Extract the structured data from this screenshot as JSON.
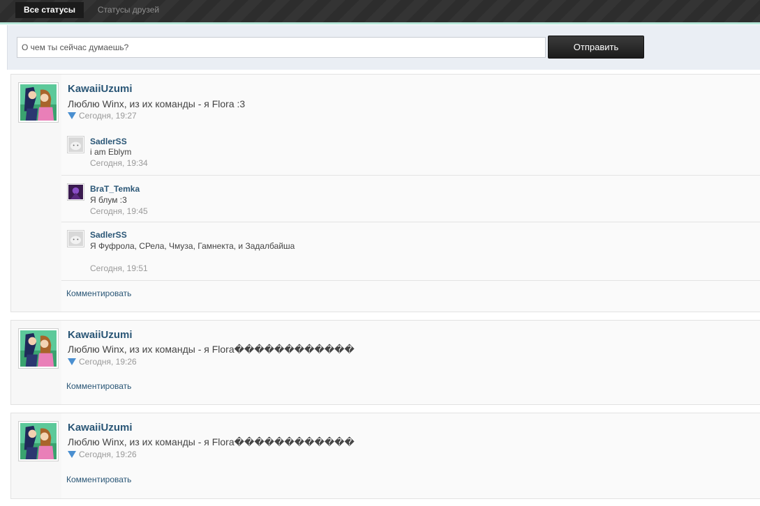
{
  "tabs": {
    "all": "Все статусы",
    "friends": "Статусы друзей"
  },
  "composer": {
    "placeholder": "О чем ты сейчас думаешь?",
    "send_label": "Отправить"
  },
  "posts": [
    {
      "author": "KawaiiUzumi",
      "text": "Люблю Winx, из их команды - я Flora :3",
      "time": "Сегодня, 19:27",
      "comments": [
        {
          "author": "SadlerSS",
          "text": "i am Eblym",
          "time": "Сегодня, 19:34"
        },
        {
          "author": "BraT_Temka",
          "text": "Я блум :3",
          "time": "Сегодня, 19:45"
        },
        {
          "author": "SadlerSS",
          "text": "Я Фуфрола, СРела, Чмуза, Гамнекта, и Задалбайша",
          "time": "Сегодня, 19:51"
        }
      ],
      "comment_link": "Комментировать"
    },
    {
      "author": "KawaiiUzumi",
      "text": "Люблю Winx, из их команды - я Flora������������",
      "time": "Сегодня, 19:26",
      "comment_link": "Комментировать"
    },
    {
      "author": "KawaiiUzumi",
      "text": "Люблю Winx, из их команды - я Flora������������",
      "time": "Сегодня, 19:26",
      "comment_link": "Комментировать"
    }
  ],
  "colors": {
    "link": "#2a5676",
    "topbar": "#2f2f2f",
    "accent_line": "#b6e6d8",
    "triangle_icon": "#4a8fd0"
  },
  "icons": {
    "status_marker": "blue-triangle-icon"
  }
}
